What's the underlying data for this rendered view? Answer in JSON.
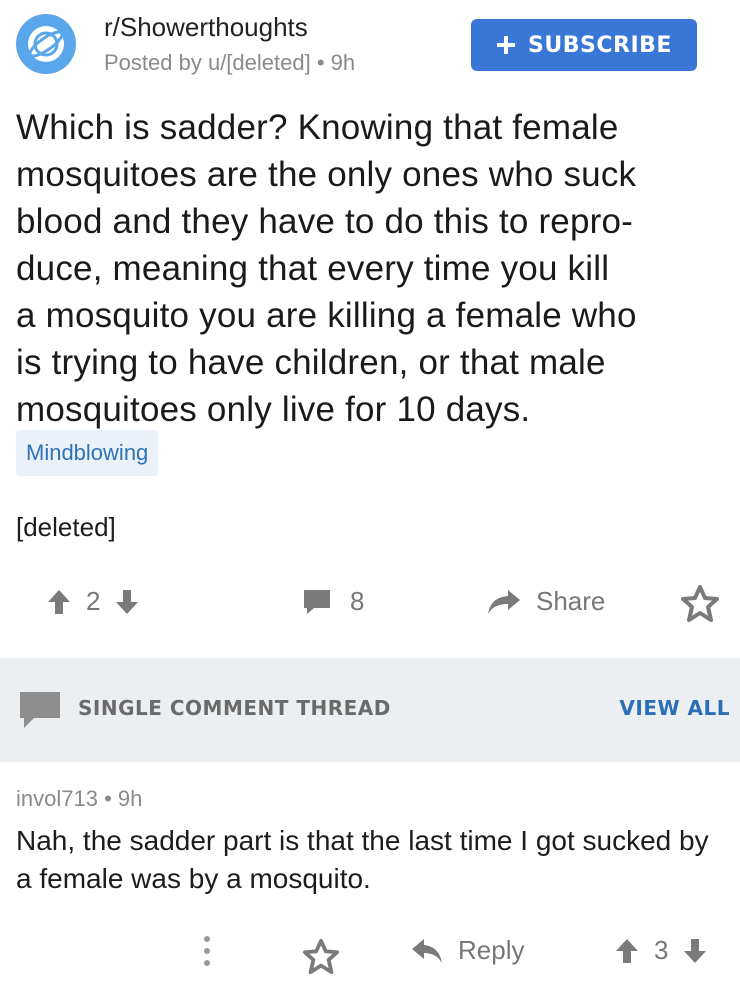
{
  "header": {
    "subreddit": "r/Showerthoughts",
    "posted_by": "Posted by u/[deleted]",
    "separator": "•",
    "post_age": "9h",
    "subscribe_label": "SUBSCRIBE"
  },
  "post": {
    "title_lines": [
      "Which is sadder? Knowing that female",
      "mosquitoes are the only ones who suck",
      "blood and they have to do this to repro-",
      "duce, meaning that every time you kill",
      "a mosquito you are killing a female who",
      "is trying to have children, or that male",
      "mosquitoes only live for 10 days."
    ],
    "flair": "Mindblowing",
    "body": "[deleted]",
    "score": "2",
    "comment_count": "8",
    "share_label": "Share"
  },
  "thread": {
    "label": "SINGLE COMMENT THREAD",
    "view_all": "VIEW ALL"
  },
  "comment": {
    "author": "invol713",
    "separator": "•",
    "age": "9h",
    "body": "Nah, the sadder part is that the last time I got sucked by a female was by a mosquito.",
    "reply_label": "Reply",
    "score": "3"
  },
  "colors": {
    "accent": "#3977d6",
    "icon_gray": "#7a7a7a",
    "banner": "#eceff2"
  },
  "icons": [
    "subreddit-planet-icon",
    "plus-icon",
    "upvote-icon",
    "downvote-icon",
    "comment-icon",
    "share-arrow-icon",
    "star-icon",
    "more-dots-icon",
    "reply-arrow-icon"
  ]
}
